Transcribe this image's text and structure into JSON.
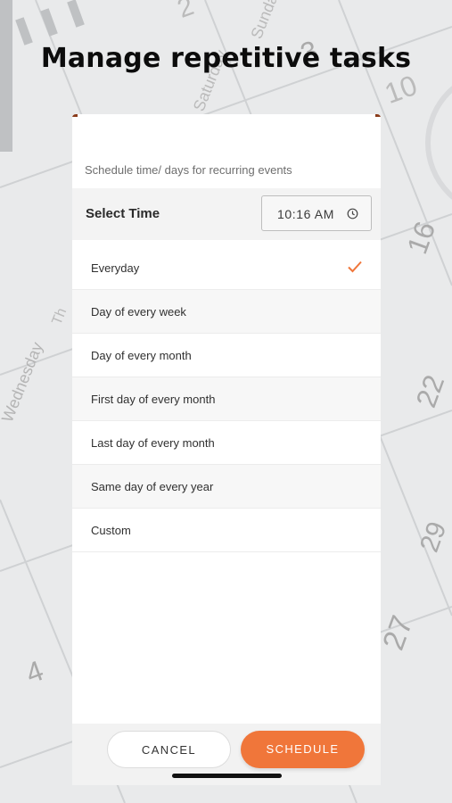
{
  "headline": "Manage repetitive tasks",
  "background": {
    "numbers": [
      "2",
      "3",
      "10",
      "16",
      "22",
      "27",
      "29",
      "4"
    ],
    "day_names": [
      "Sunday",
      "Saturday",
      "Wednesday",
      "Th"
    ]
  },
  "dialog": {
    "subtitle": "Schedule time/ days for recurring events",
    "select_time_label": "Select Time",
    "time_value": "10:16 AM",
    "options": [
      {
        "label": "Everyday",
        "selected": true
      },
      {
        "label": "Day of every week",
        "selected": false
      },
      {
        "label": "Day of every month",
        "selected": false
      },
      {
        "label": "First day of every month",
        "selected": false
      },
      {
        "label": "Last day of every month",
        "selected": false
      },
      {
        "label": "Same day of every year",
        "selected": false
      },
      {
        "label": "Custom",
        "selected": false
      }
    ],
    "cancel_label": "CANCEL",
    "schedule_label": "SCHEDULE"
  },
  "colors": {
    "accent": "#f0763a",
    "checkmark": "#f0763a",
    "background": "#e9eaeb"
  },
  "icons": {
    "time_field": "clock-icon",
    "selected_option": "check-icon"
  }
}
